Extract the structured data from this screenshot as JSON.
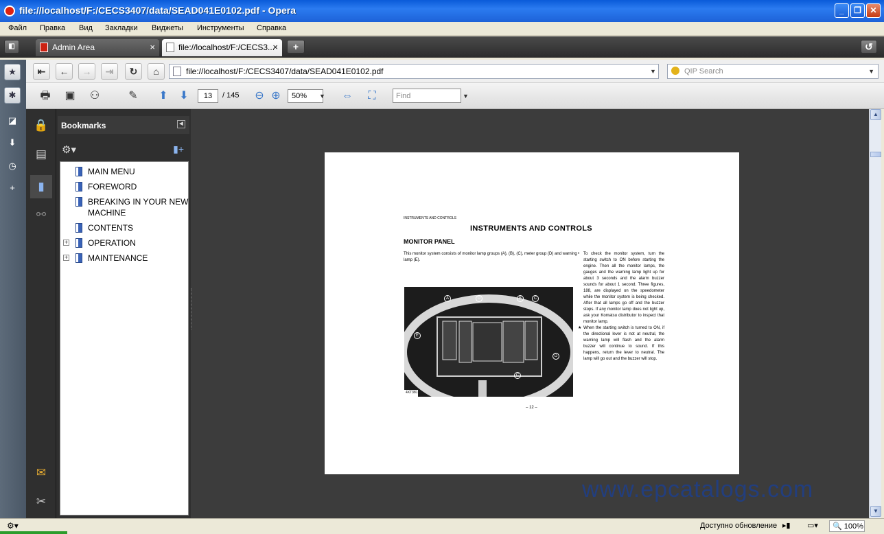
{
  "window": {
    "title": "file://localhost/F:/CECS3407/data/SEAD041E0102.pdf - Opera"
  },
  "menu": [
    "Файл",
    "Правка",
    "Вид",
    "Закладки",
    "Виджеты",
    "Инструменты",
    "Справка"
  ],
  "tabs": [
    {
      "label": "Admin Area",
      "close": "×"
    },
    {
      "label": "file://localhost/F:/CECS3...",
      "close": "×"
    }
  ],
  "new_tab": "+",
  "address": {
    "url": "file://localhost/F:/CECS3407/data/SEAD041E0102.pdf"
  },
  "search": {
    "placeholder": "QIP Search"
  },
  "pdf_toolbar": {
    "current_page": "13",
    "total_pages": "/ 145",
    "zoom": "50%",
    "find_placeholder": "Find"
  },
  "bookmarks": {
    "header": "Bookmarks",
    "items": [
      {
        "label": "MAIN MENU",
        "expandable": false
      },
      {
        "label": "FOREWORD",
        "expandable": false
      },
      {
        "label": "BREAKING IN YOUR NEW MACHINE",
        "expandable": false
      },
      {
        "label": "CONTENTS",
        "expandable": false
      },
      {
        "label": "OPERATION",
        "expandable": true
      },
      {
        "label": "MAINTENANCE",
        "expandable": true
      }
    ]
  },
  "document": {
    "running_header": "INSTRUMENTS AND CONTROLS",
    "title": "INSTRUMENTS AND CONTROLS",
    "subtitle": "MONITOR PANEL",
    "intro": "This monitor system consists of monitor lamp groups (A), (B), (C), meter group (D) and warning lamp (E).",
    "bullet1": "To check the monitor system, turn the starting switch to ON before starting the engine. Then all the monitor lamps, the gauges and the warning lamp light up for about 3 seconds and the alarm buzzer sounds for about 1 second. Three figures, 188, are displayed on the speedometer while the monitor system is being checked. After that all lamps go off and the buzzer stops. If any monitor lamp does not light up, ask your Komatsu distributor to inspect that monitor lamp.",
    "bullet2": "When the starting switch is turned to ON, if the directional lever is not at neutral, the warning lamp will flash and the alarm buzzer will continue to sound. If this happens, return the lever to neutral. The lamp will go out and the buzzer will stop.",
    "bullet1_marker": "•",
    "bullet2_marker": "★",
    "photo_labels": [
      "A",
      "D",
      "B",
      "C",
      "E",
      "D",
      "C"
    ],
    "photo_code": "4XT381",
    "page_number": "– 12 –"
  },
  "watermark": "www.epcatalogs.com",
  "status": {
    "update_text": "Доступно обновление",
    "zoom": "100%"
  }
}
